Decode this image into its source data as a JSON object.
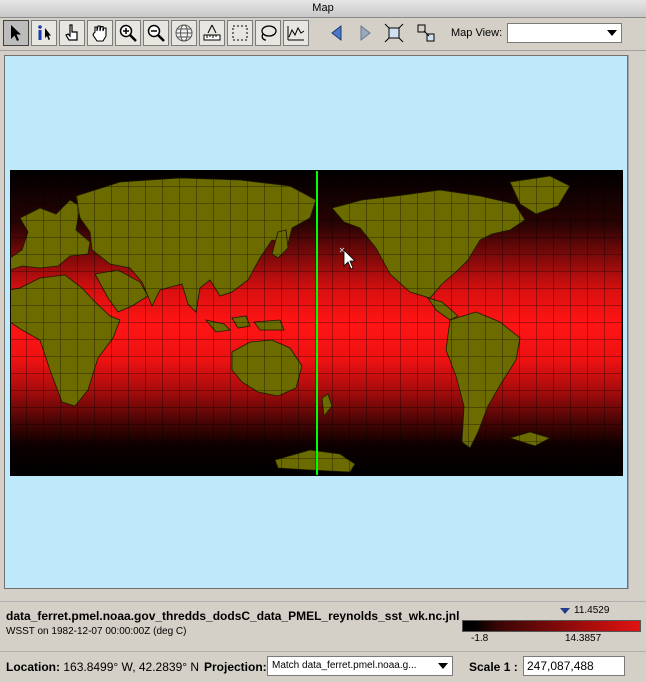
{
  "window": {
    "title": "Map"
  },
  "toolbar": {
    "tools": [
      "select-arrow-icon",
      "info-icon",
      "pointer-hand-icon",
      "pan-hand-icon",
      "zoom-in-icon",
      "zoom-out-icon",
      "globe-icon",
      "measure-icon",
      "box-select-icon",
      "lasso-icon",
      "profile-icon"
    ],
    "nav": [
      "back-arrow-icon",
      "forward-arrow-icon",
      "zoom-full-icon",
      "zoom-selected-icon"
    ],
    "map_view_label": "Map View:",
    "map_view_value": ""
  },
  "map": {
    "colors": {
      "land": "#6b6b00",
      "ocean_warm": "#ff1414",
      "ocean_cold": "#000000",
      "background": "#bde9fb",
      "cursor_line": "#00ff00",
      "grid": "#000000"
    }
  },
  "info": {
    "dataset_name": "data_ferret.pmel.noaa.gov_thredds_dodsC_data_PMEL_reynolds_sst_wk.nc.jnl",
    "variable_desc": "WSST on 1982-12-07 00:00:00Z (deg C)",
    "colorbar": {
      "max": "11.4529",
      "min": "-1.8",
      "mid": "14.3857"
    }
  },
  "status": {
    "location_label": "Location:",
    "location_value": "163.8499° W, 42.2839° N",
    "projection_label": "Projection:",
    "projection_value": "Match data_ferret.pmel.noaa.g...",
    "scale_label": "Scale 1 :",
    "scale_value": "247,087,488"
  }
}
